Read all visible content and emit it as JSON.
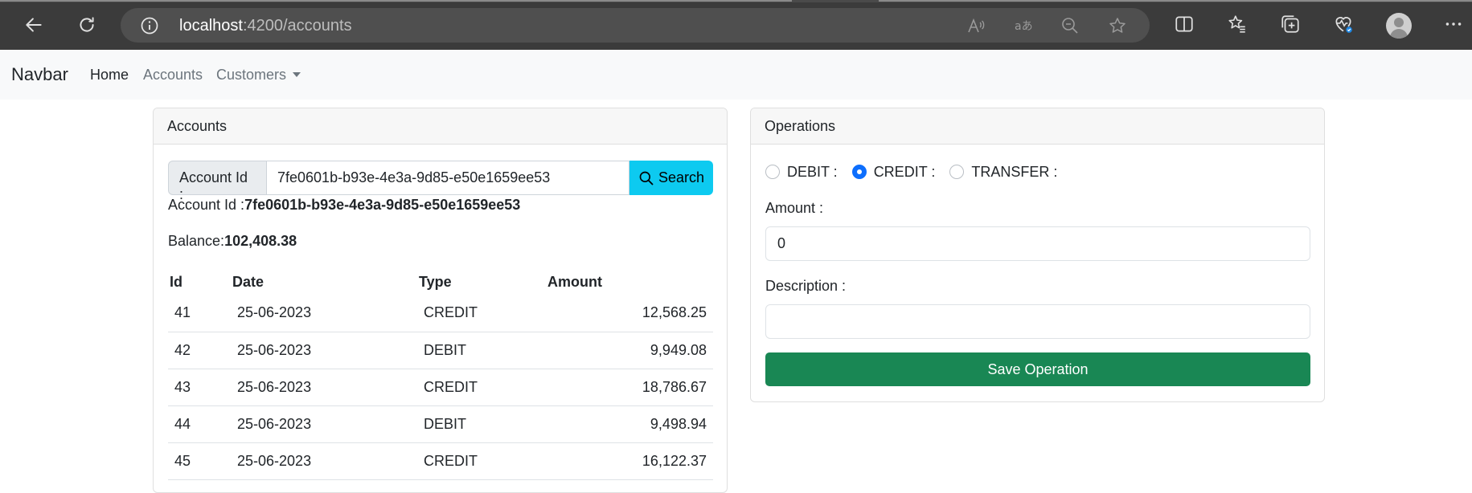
{
  "browser": {
    "url_host": "localhost",
    "url_rest": ":4200/accounts"
  },
  "navbar": {
    "brand": "Navbar",
    "links": [
      {
        "label": "Home",
        "active": true
      },
      {
        "label": "Accounts",
        "active": false
      },
      {
        "label": "Customers",
        "active": false
      }
    ]
  },
  "accounts": {
    "header": "Accounts",
    "search": {
      "label": "Account Id :",
      "value": "7fe0601b-b93e-4e3a-9d85-e50e1659ee53",
      "button": "Search"
    },
    "account_id_label": "Account Id :",
    "account_id_value": "7fe0601b-b93e-4e3a-9d85-e50e1659ee53",
    "balance_label": "Balance:",
    "balance_value": "102,408.38",
    "table": {
      "columns": [
        "Id",
        "Date",
        "Type",
        "Amount"
      ],
      "rows": [
        {
          "id": "41",
          "date": "25-06-2023",
          "type": "CREDIT",
          "amount": "12,568.25"
        },
        {
          "id": "42",
          "date": "25-06-2023",
          "type": "DEBIT",
          "amount": "9,949.08"
        },
        {
          "id": "43",
          "date": "25-06-2023",
          "type": "CREDIT",
          "amount": "18,786.67"
        },
        {
          "id": "44",
          "date": "25-06-2023",
          "type": "DEBIT",
          "amount": "9,498.94"
        },
        {
          "id": "45",
          "date": "25-06-2023",
          "type": "CREDIT",
          "amount": "16,122.37"
        }
      ]
    }
  },
  "operations": {
    "header": "Operations",
    "radios": [
      {
        "label": "DEBIT :",
        "checked": false
      },
      {
        "label": "CREDIT :",
        "checked": true
      },
      {
        "label": "TRANSFER :",
        "checked": false
      }
    ],
    "amount_label": "Amount :",
    "amount_value": "0",
    "description_label": "Description :",
    "description_value": "",
    "save_button": "Save Operation"
  },
  "colors": {
    "chrome_bg": "#3b3b3b",
    "search_button": "#0dcaf0",
    "save_button": "#198754",
    "radio_checked": "#0d6efd"
  }
}
